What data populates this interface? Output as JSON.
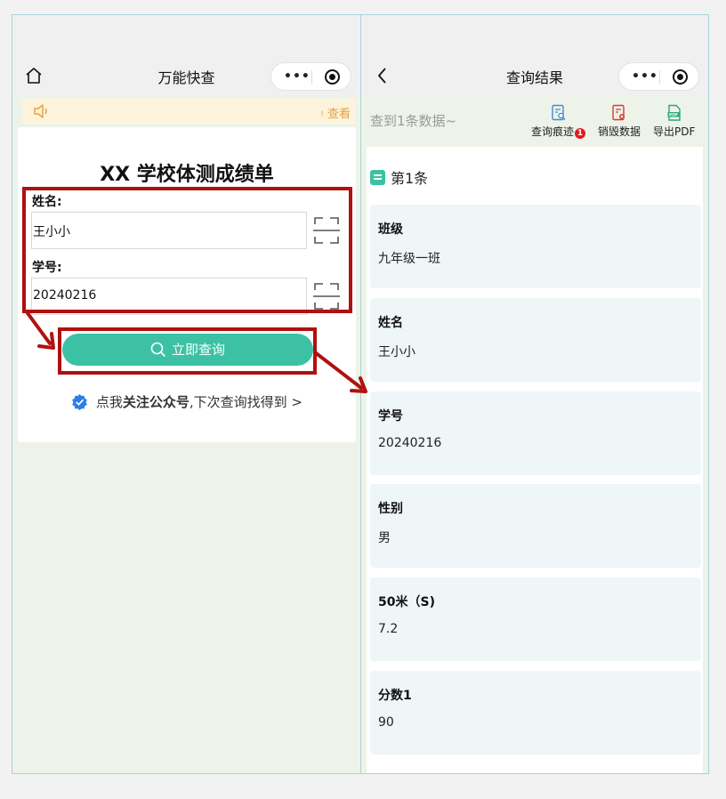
{
  "left": {
    "nav_title": "万能快查",
    "capsule_dots": "•••",
    "notice_more": "查看",
    "card_title": "XX 学校体测成绩单",
    "fields": [
      {
        "label": "姓名:",
        "value": "王小小"
      },
      {
        "label": "学号:",
        "value": "20240216"
      }
    ],
    "query_button": "立即查询",
    "follow": {
      "prefix": "点我",
      "bold": "关注公众号",
      "suffix": ",下次查询找得到 >"
    }
  },
  "right": {
    "nav_title": "查询结果",
    "capsule_dots": "•••",
    "found": "查到1条数据~",
    "tools": [
      {
        "label": "查询痕迹",
        "badge": "1"
      },
      {
        "label": "销毁数据"
      },
      {
        "label": "导出PDF"
      }
    ],
    "entry_title": "第1条",
    "results": [
      {
        "key": "班级",
        "value": "九年级一班"
      },
      {
        "key": "姓名",
        "value": "王小小"
      },
      {
        "key": "学号",
        "value": "20240216"
      },
      {
        "key": "性别",
        "value": "男"
      },
      {
        "key": "50米（S)",
        "value": "7.2"
      },
      {
        "key": "分数1",
        "value": "90"
      }
    ]
  },
  "colors": {
    "accent": "#3cc1a5",
    "highlight": "#b11010",
    "notice_bg": "#fdf3dc"
  }
}
